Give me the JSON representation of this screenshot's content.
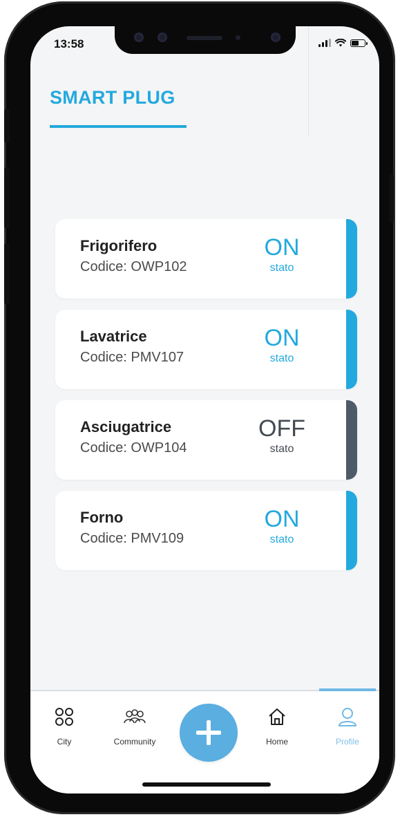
{
  "status_bar": {
    "time": "13:58"
  },
  "header": {
    "title": "SMART PLUG"
  },
  "devices": [
    {
      "name": "Frigorifero",
      "code": "Codice: OWP102",
      "state": "ON",
      "state_label": "stato",
      "state_color": "#23a9dd",
      "bar_color": "#23a9dd"
    },
    {
      "name": "Lavatrice",
      "code": "Codice: PMV107",
      "state": "ON",
      "state_label": "stato",
      "state_color": "#23a9dd",
      "bar_color": "#23a9dd"
    },
    {
      "name": "Asciugatrice",
      "code": "Codice: OWP104",
      "state": "OFF",
      "state_label": "stato",
      "state_color": "#444a52",
      "bar_color": "#4d5a68"
    },
    {
      "name": "Forno",
      "code": "Codice: PMV109",
      "state": "ON",
      "state_label": "stato",
      "state_color": "#23a9dd",
      "bar_color": "#23a9dd"
    }
  ],
  "nav": {
    "items": [
      {
        "label": "City",
        "icon": "city-grid-icon"
      },
      {
        "label": "Community",
        "icon": "community-icon"
      },
      {
        "label": "Home",
        "icon": "home-icon"
      },
      {
        "label": "Profile",
        "icon": "profile-icon",
        "active": true
      }
    ],
    "fab_icon": "plus-icon",
    "active_color": "#6fb8e6"
  }
}
